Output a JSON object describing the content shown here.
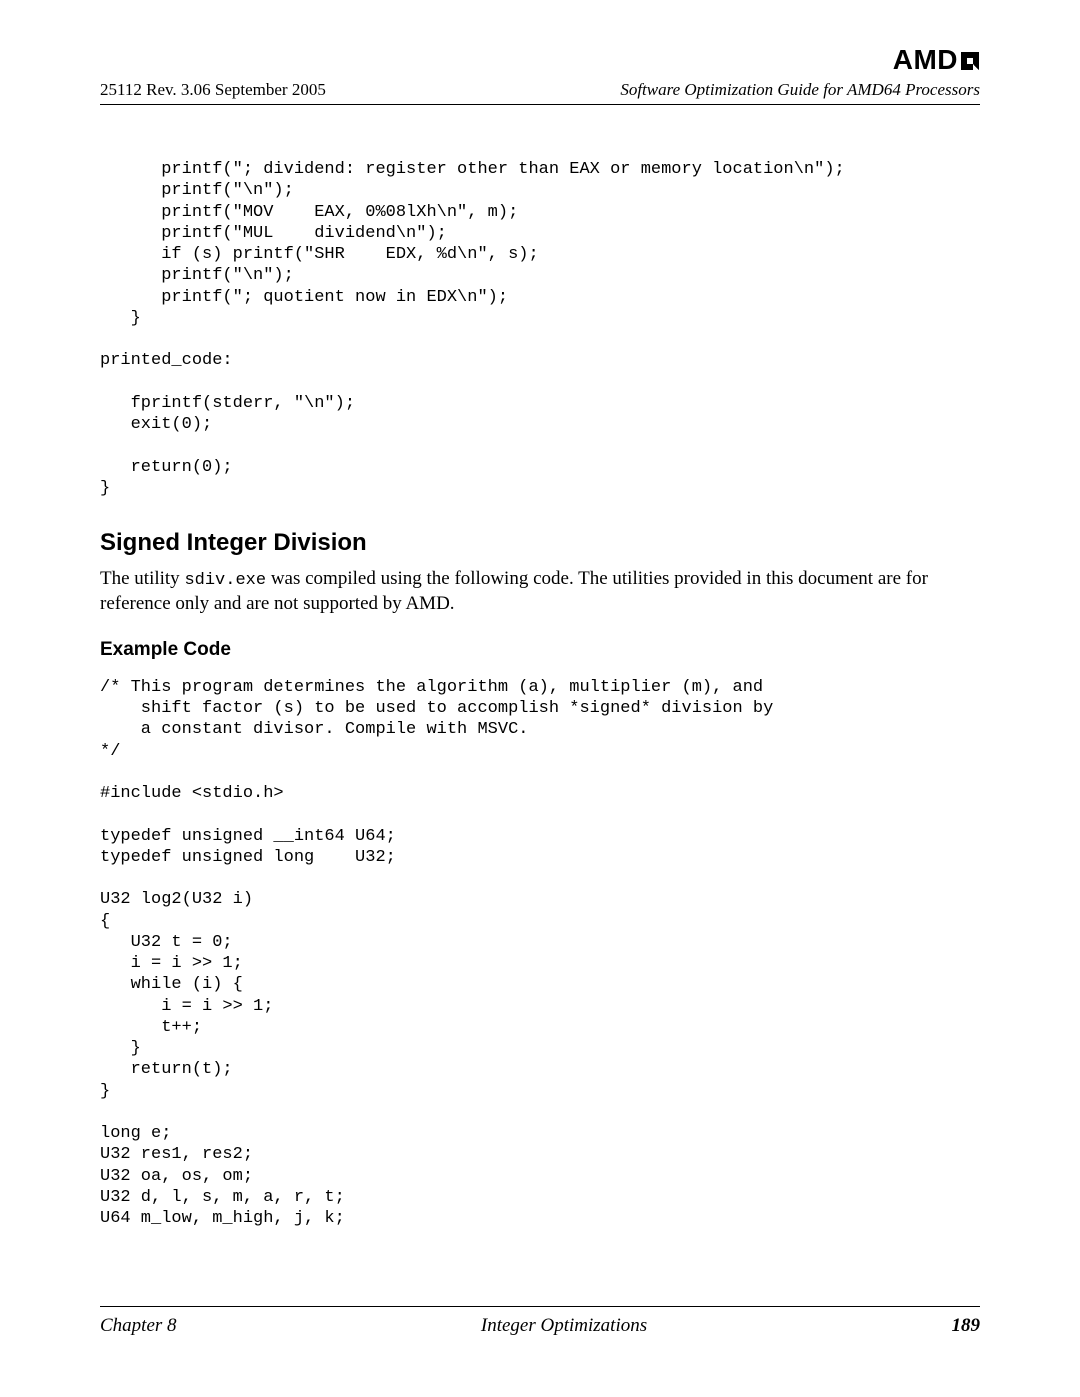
{
  "brand": "AMD",
  "header": {
    "left": "25112   Rev. 3.06   September 2005",
    "right": "Software Optimization Guide for AMD64 Processors"
  },
  "code_top": "      printf(\"; dividend: register other than EAX or memory location\\n\");\n      printf(\"\\n\");\n      printf(\"MOV    EAX, 0%08lXh\\n\", m);\n      printf(\"MUL    dividend\\n\");\n      if (s) printf(\"SHR    EDX, %d\\n\", s);\n      printf(\"\\n\");\n      printf(\"; quotient now in EDX\\n\");\n   }\n\nprinted_code:\n\n   fprintf(stderr, \"\\n\");\n   exit(0);\n\n   return(0);\n}",
  "section_heading": "Signed Integer Division",
  "para_prefix": "The utility ",
  "para_mono": "sdiv.exe",
  "para_suffix": " was compiled using the following code. The utilities provided in this document are for reference only and are not supported by AMD.",
  "example_heading": "Example Code",
  "code_bottom": "/* This program determines the algorithm (a), multiplier (m), and\n    shift factor (s) to be used to accomplish *signed* division by\n    a constant divisor. Compile with MSVC.\n*/\n\n#include <stdio.h>\n\ntypedef unsigned __int64 U64;\ntypedef unsigned long    U32;\n\nU32 log2(U32 i)\n{\n   U32 t = 0;\n   i = i >> 1;\n   while (i) {\n      i = i >> 1;\n      t++;\n   }\n   return(t);\n}\n\nlong e;\nU32 res1, res2;\nU32 oa, os, om;\nU32 d, l, s, m, a, r, t;\nU64 m_low, m_high, j, k;",
  "footer": {
    "left": "Chapter 8",
    "center": "Integer Optimizations",
    "right": "189"
  }
}
